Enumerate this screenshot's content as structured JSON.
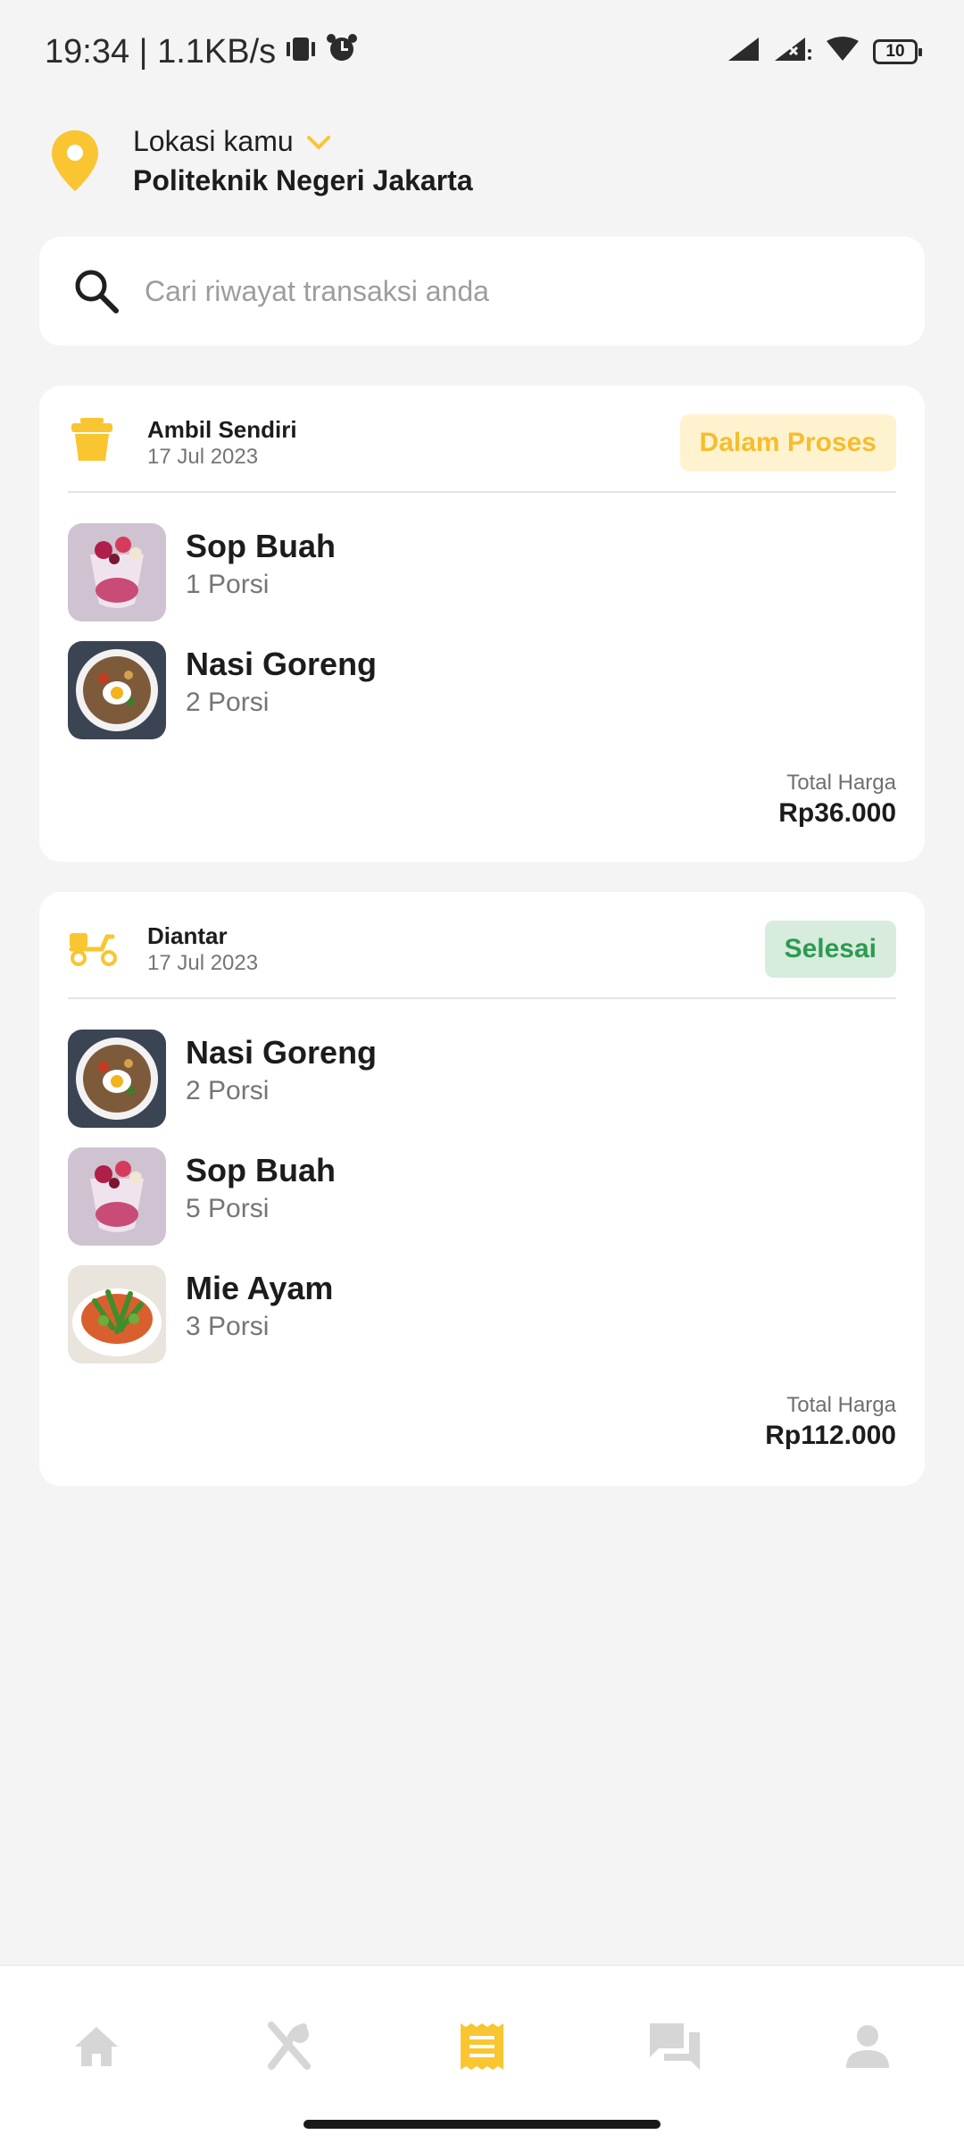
{
  "status_bar": {
    "time_text": "19:34 | 1.1KB/s",
    "battery": "10"
  },
  "location": {
    "caption": "Lokasi kamu",
    "name": "Politeknik Negeri Jakarta"
  },
  "search": {
    "placeholder": "Cari riwayat transaksi anda"
  },
  "orders": [
    {
      "type": "Ambil Sendiri",
      "date": "17 Jul 2023",
      "status": "Dalam Proses",
      "items": [
        {
          "name": "Sop Buah",
          "qty": "1 Porsi"
        },
        {
          "name": "Nasi Goreng",
          "qty": "2 Porsi"
        }
      ],
      "total_label": "Total Harga",
      "total": "Rp36.000"
    },
    {
      "type": "Diantar",
      "date": "17 Jul 2023",
      "status": "Selesai",
      "items": [
        {
          "name": "Nasi Goreng",
          "qty": "2 Porsi"
        },
        {
          "name": "Sop Buah",
          "qty": "5 Porsi"
        },
        {
          "name": "Mie Ayam",
          "qty": "3 Porsi"
        }
      ],
      "total_label": "Total Harga",
      "total": "Rp112.000"
    }
  ],
  "bottom_nav": {
    "items": [
      {
        "icon": "home-icon",
        "active": false
      },
      {
        "icon": "restaurant-icon",
        "active": false
      },
      {
        "icon": "receipt-icon",
        "active": true
      },
      {
        "icon": "chat-icon",
        "active": false
      },
      {
        "icon": "profile-icon",
        "active": false
      }
    ]
  },
  "colors": {
    "accent": "#f9c531",
    "inactive_icon": "#d6d6d6",
    "in_process_bg": "#fff3cf",
    "in_process_text": "#f5bd2f",
    "done_bg": "#d7ecdc",
    "done_text": "#2d9a53"
  }
}
